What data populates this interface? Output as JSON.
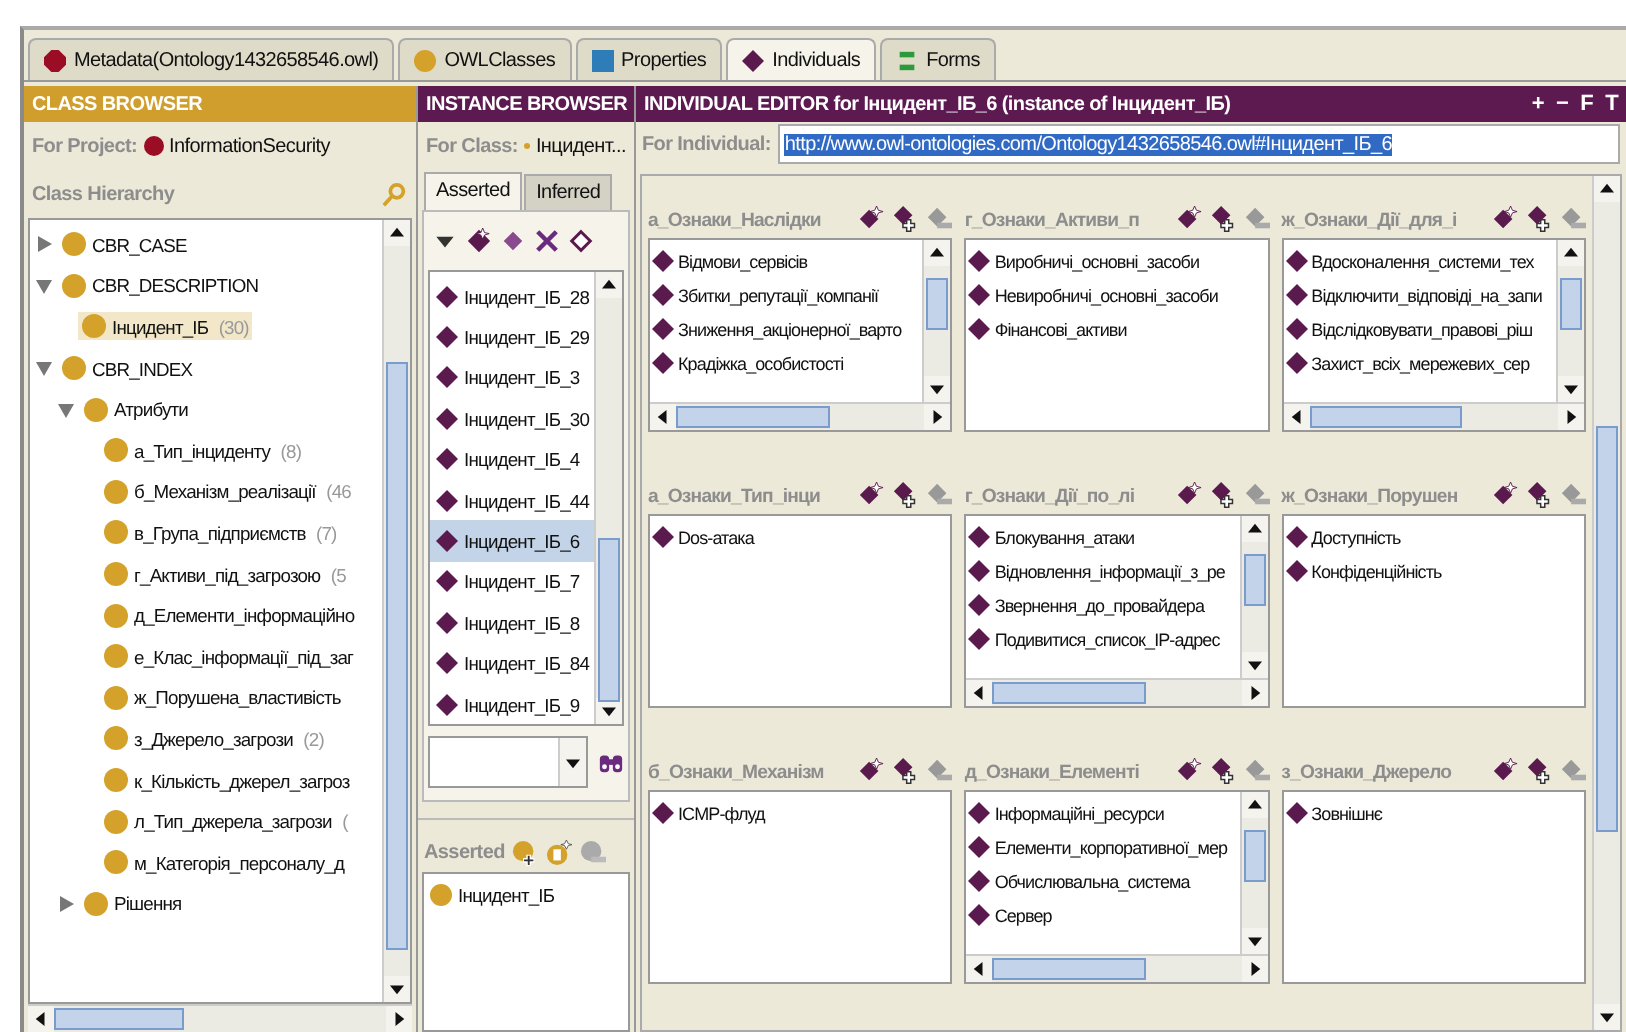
{
  "tabs": [
    {
      "label": "Metadata(Ontology1432658546.owl)",
      "kind": "metadata",
      "selected": false
    },
    {
      "label": "OWLClasses",
      "kind": "classes",
      "selected": false
    },
    {
      "label": "Properties",
      "kind": "properties",
      "selected": false
    },
    {
      "label": "Individuals",
      "kind": "individuals",
      "selected": true
    },
    {
      "label": "Forms",
      "kind": "forms",
      "selected": false
    }
  ],
  "class_browser": {
    "title": "CLASS BROWSER",
    "project_label": "For Project:",
    "project": "InformationSecurity",
    "hierarchy_label": "Class Hierarchy",
    "tree": [
      {
        "name": "CBR_CASE",
        "expanded": false
      },
      {
        "name": "CBR_DESCRIPTION",
        "expanded": true,
        "children": [
          {
            "name": "Інцидент_ІБ",
            "count": "(30)",
            "selected": true
          }
        ]
      },
      {
        "name": "CBR_INDEX",
        "expanded": true,
        "children": [
          {
            "name": "Атрибути",
            "expanded": true,
            "children": [
              {
                "name": "а_Тип_інциденту",
                "count": "(8)",
                "selected": false
              },
              {
                "name": "б_Механізм_реалізації",
                "count": "(46",
                "selected": false
              },
              {
                "name": "в_Група_підприємств",
                "count": "(7)",
                "selected": false
              },
              {
                "name": "г_Активи_під_загрозою",
                "count": "(5",
                "selected": false
              },
              {
                "name": "д_Елементи_інформаційно",
                "selected": false
              },
              {
                "name": "е_Клас_інформації_під_заг",
                "selected": false
              },
              {
                "name": "ж_Порушена_властивість",
                "selected": false
              },
              {
                "name": "з_Джерело_загрози",
                "count": "(2)",
                "selected": false
              },
              {
                "name": "к_Кількість_джерел_загроз",
                "selected": false
              },
              {
                "name": "л_Тип_джерела_загрози",
                "count": "(",
                "selected": false
              },
              {
                "name": "м_Категорія_персоналу_д",
                "selected": false
              }
            ]
          },
          {
            "name": "Рішення",
            "expanded": false
          }
        ]
      }
    ]
  },
  "instance_browser": {
    "title": "INSTANCE BROWSER",
    "class_label": "For Class:",
    "class_name": "Інцидент...",
    "tabs": [
      {
        "label": "Asserted",
        "selected": true
      },
      {
        "label": "Inferred",
        "selected": false
      }
    ],
    "instances": [
      {
        "name": "Інцидент_ІБ_28",
        "selected": false
      },
      {
        "name": "Інцидент_ІБ_29",
        "selected": false
      },
      {
        "name": "Інцидент_ІБ_3",
        "selected": false
      },
      {
        "name": "Інцидент_ІБ_30",
        "selected": false
      },
      {
        "name": "Інцидент_ІБ_4",
        "selected": false
      },
      {
        "name": "Інцидент_ІБ_44",
        "selected": false
      },
      {
        "name": "Інцидент_ІБ_6",
        "selected": true
      },
      {
        "name": "Інцидент_ІБ_7",
        "selected": false
      },
      {
        "name": "Інцидент_ІБ_8",
        "selected": false
      },
      {
        "name": "Інцидент_ІБ_84",
        "selected": false
      },
      {
        "name": "Інцидент_ІБ_9",
        "selected": false
      }
    ],
    "types_label": "Asserted",
    "types": [
      "Інцидент_ІБ"
    ]
  },
  "individual_editor": {
    "title": "INDIVIDUAL EDITOR for Інцидент_ІБ_6  (instance of Інцидент_ІБ)",
    "buttons": [
      "+",
      "−",
      "F",
      "T"
    ],
    "individual_label": "For Individual:",
    "individual_uri": "http://www.owl-ontologies.com/Ontology1432658546.owl#Інцидент_ІБ_6",
    "uri_selected": true,
    "properties": [
      {
        "label": "а_Ознаки_Наслідки",
        "scrollbars": true,
        "values": [
          "Відмови_сервісів",
          "Збитки_репутації_компанії",
          "Зниження_акціонерної_варто",
          "Крадіжка_особистості"
        ]
      },
      {
        "label": "г_Ознаки_Активи_п",
        "scrollbars": false,
        "values": [
          "Виробничі_основні_засоби",
          "Невиробничі_основні_засоби",
          "Фінансові_активи"
        ]
      },
      {
        "label": "ж_Ознаки_Дії_для_і",
        "scrollbars": true,
        "values": [
          "Вдосконалення_системи_тех",
          "Відключити_відповіді_на_запи",
          "Відслідковувати_правові_ріш",
          "Захист_всіх_мережевих_сер"
        ]
      },
      {
        "label": "а_Ознаки_Тип_інци",
        "scrollbars": false,
        "values": [
          "Dos-атака"
        ]
      },
      {
        "label": "г_Ознаки_Дії_по_лі",
        "scrollbars": true,
        "values": [
          "Блокування_атаки",
          "Відновлення_інформації_з_ре",
          "Звернення_до_провайдера",
          "Подивитися_список_IP-адрес"
        ]
      },
      {
        "label": "ж_Ознаки_Порушен",
        "scrollbars": false,
        "values": [
          "Доступність",
          "Конфіденційність"
        ]
      },
      {
        "label": "б_Ознаки_Механізм",
        "scrollbars": false,
        "values": [
          "ICMP-флуд"
        ]
      },
      {
        "label": "д_Ознаки_Елементі",
        "scrollbars": true,
        "values": [
          "Інформаційні_ресурси",
          "Елементи_корпоративної_мер",
          "Обчислювальна_система",
          "Сервер"
        ]
      },
      {
        "label": "з_Ознаки_Джерело",
        "scrollbars": false,
        "values": [
          "Зовнішнє"
        ]
      }
    ]
  }
}
